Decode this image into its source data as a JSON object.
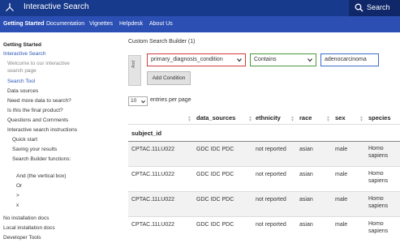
{
  "app": {
    "title": "Interactive Search"
  },
  "search": {
    "label": "Search"
  },
  "nav": [
    {
      "label": "Getting Started",
      "active": true
    },
    {
      "label": "Documentation"
    },
    {
      "label": "Vignettes"
    },
    {
      "label": "Helpdesk"
    },
    {
      "label": "About Us"
    }
  ],
  "sidebar": {
    "items": [
      {
        "label": "Getting Started"
      },
      {
        "label": "Interactive Search"
      },
      {
        "label": "Welcome to our interactive search page"
      },
      {
        "label": "Search Tool"
      },
      {
        "label": "Data sources"
      },
      {
        "label": "Need more data to search?"
      },
      {
        "label": "Is this the final product?"
      },
      {
        "label": "Questions and Comments"
      },
      {
        "label": "Interactive search instructions"
      },
      {
        "label": "Quick start"
      },
      {
        "label": "Saving your results"
      },
      {
        "label": "Search Builder functions:"
      },
      {
        "label": "And (the vertical box)"
      },
      {
        "label": "Or"
      },
      {
        "label": ">"
      },
      {
        "label": "x"
      },
      {
        "label": "No installation docs"
      },
      {
        "label": "Local installation docs"
      },
      {
        "label": "Developer Tools"
      }
    ]
  },
  "builder": {
    "title": "Custom Search Builder (1)",
    "logic_label": "And",
    "field_value": "primary_diagnosis_condition",
    "operator_value": "Contains",
    "value_input": "adenocarcinoma",
    "add_condition_label": "Add Condition"
  },
  "entries": {
    "value": "10",
    "label": "entries per page"
  },
  "table": {
    "columns": [
      "data_sources",
      "ethnicity",
      "race",
      "sex",
      "species"
    ],
    "subject_header": "subject_id",
    "rows": [
      {
        "subject_id": "CPTAC.11LU022",
        "data_sources": "GDC IDC PDC",
        "ethnicity": "not reported",
        "race": "asian",
        "sex": "male",
        "species": "Homo sapiens"
      },
      {
        "subject_id": "CPTAC.11LU022",
        "data_sources": "GDC IDC PDC",
        "ethnicity": "not reported",
        "race": "asian",
        "sex": "male",
        "species": "Homo sapiens"
      },
      {
        "subject_id": "CPTAC.11LU022",
        "data_sources": "GDC IDC PDC",
        "ethnicity": "not reported",
        "race": "asian",
        "sex": "male",
        "species": "Homo sapiens"
      },
      {
        "subject_id": "CPTAC.11LU022",
        "data_sources": "GDC IDC PDC",
        "ethnicity": "not reported",
        "race": "asian",
        "sex": "male",
        "species": "Homo sapiens"
      }
    ]
  },
  "colors": {
    "topbar": "#183a8c",
    "navbar": "#2c4fb4",
    "link": "#2a56b8"
  }
}
